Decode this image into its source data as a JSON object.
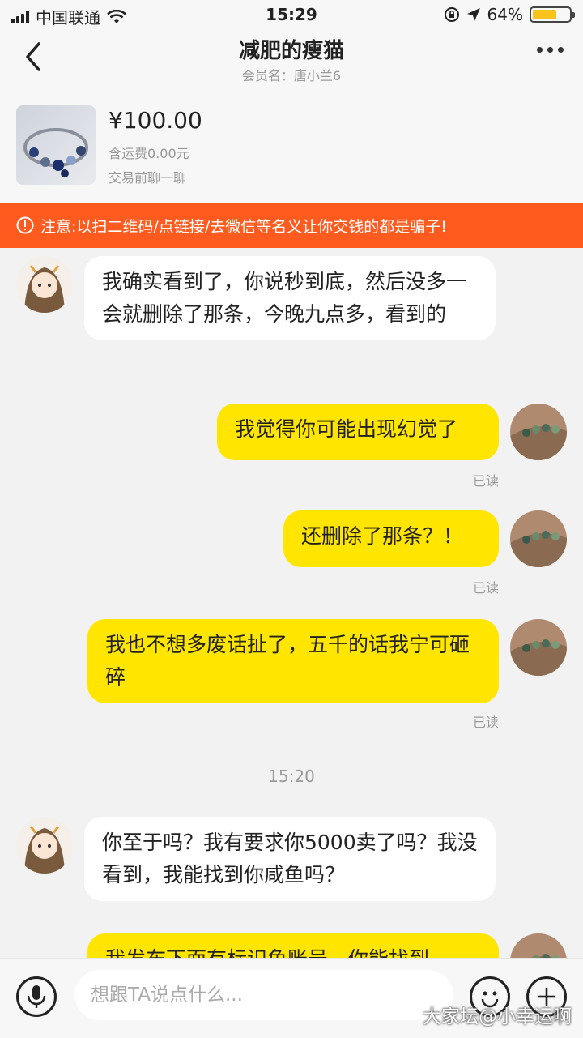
{
  "status": {
    "carrier": "中国联通",
    "time": "15:29",
    "battery": "64%"
  },
  "header": {
    "title": "减肥的瘦猫",
    "member": "会员名：唐小兰6"
  },
  "product": {
    "price": "¥100.00",
    "shipping": "含运费0.00元",
    "hint": "交易前聊一聊"
  },
  "warning": "注意:以扫二维码/点链接/去微信等名义让你交钱的都是骗子!",
  "messages": [
    {
      "text": "我确实看到了，你说秒到底，然后没多一会就删除了那条，今晚九点多，看到的"
    },
    {
      "text": "我觉得你可能出现幻觉了",
      "read": "已读"
    },
    {
      "text": "还删除了那条？！",
      "read": "已读"
    },
    {
      "text": "我也不想多废话扯了，五千的话我宁可砸碎",
      "read": "已读"
    },
    {
      "timestamp": "15:20"
    },
    {
      "text": "你至于吗？我有要求你5000卖了吗？我没看到，我能找到你咸鱼吗？"
    },
    {
      "text": "我发布下面有标识鱼账号，你能找到"
    }
  ],
  "input": {
    "placeholder": "想跟TA说点什么..."
  },
  "watermark": "大家坛@小幸运啊",
  "colors": {
    "accent": "#ffe500",
    "warning": "#ff5b1f"
  }
}
